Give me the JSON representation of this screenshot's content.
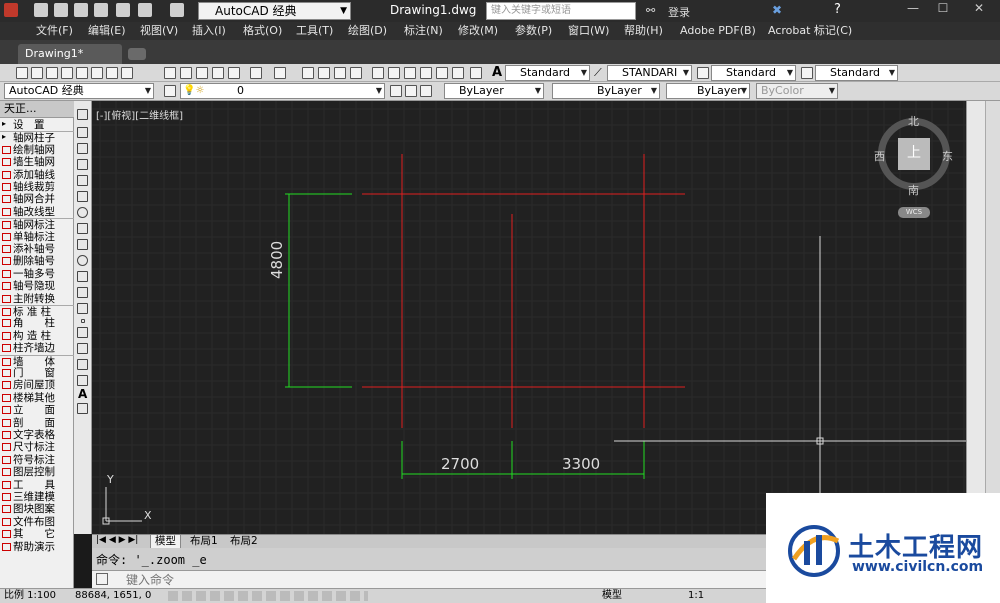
{
  "title_bar": {
    "workspace": "AutoCAD 经典",
    "document_title": "Drawing1.dwg",
    "search_placeholder": "键入关键字或短语",
    "login": "登录"
  },
  "menu": [
    "文件(F)",
    "编辑(E)",
    "视图(V)",
    "插入(I)",
    "格式(O)",
    "工具(T)",
    "绘图(D)",
    "标注(N)",
    "修改(M)",
    "参数(P)",
    "窗口(W)",
    "帮助(H)",
    "Adobe PDF(B)",
    "Acrobat 标记(C)"
  ],
  "doc_tab": "Drawing1*",
  "toolbar1": {
    "text_style": "Standard",
    "dim_style": "STANDARI",
    "table_style": "Standard",
    "multileader_style": "Standard"
  },
  "toolbar2": {
    "workspace": "AutoCAD 经典",
    "layer": "0",
    "color": "ByLayer",
    "linetype": "ByLayer",
    "lineweight": "ByLayer",
    "plotstyle": "ByColor"
  },
  "palette": {
    "title": "天正...",
    "items": [
      "设　置",
      "轴网柱子",
      "绘制轴网",
      "墙生轴网",
      "添加轴线",
      "轴线裁剪",
      "轴网合并",
      "轴改线型",
      "轴网标注",
      "单轴标注",
      "添补轴号",
      "删除轴号",
      "一轴多号",
      "轴号隐现",
      "主附转换",
      "标 准 柱",
      "角　　柱",
      "构 造 柱",
      "柱齐墙边",
      "墙　　体",
      "门　　窗",
      "房间屋顶",
      "楼梯其他",
      "立　　面",
      "剖　　面",
      "文字表格",
      "尺寸标注",
      "符号标注",
      "图层控制",
      "工　　具",
      "三维建模",
      "图块图案",
      "文件布图",
      "其　　它",
      "帮助演示"
    ]
  },
  "viewport": {
    "label": "[-][俯视][二维线框]",
    "compass": {
      "north": "北",
      "south": "南",
      "east": "东",
      "west": "西",
      "top": "上"
    },
    "wcs": "WCS",
    "ucs_y": "Y",
    "ucs_x": "X"
  },
  "drawing": {
    "dim_vertical": "4800",
    "dim_h1": "2700",
    "dim_h2": "3300"
  },
  "layout_tabs": [
    "模型",
    "布局1",
    "布局2"
  ],
  "command": {
    "history": "命令: '_.zoom _e",
    "placeholder": "键入命令"
  },
  "status_bar": {
    "scale": "比例 1:100",
    "coords": "88684, 1651, 0",
    "model": "模型",
    "annotation_scale": "1:1"
  },
  "watermark": {
    "title": "土木工程网",
    "url": "www.civilcn.com"
  },
  "colors": {
    "axis_red": "#e02020",
    "dim_green": "#22dd22",
    "canvas_bg": "#212121"
  }
}
